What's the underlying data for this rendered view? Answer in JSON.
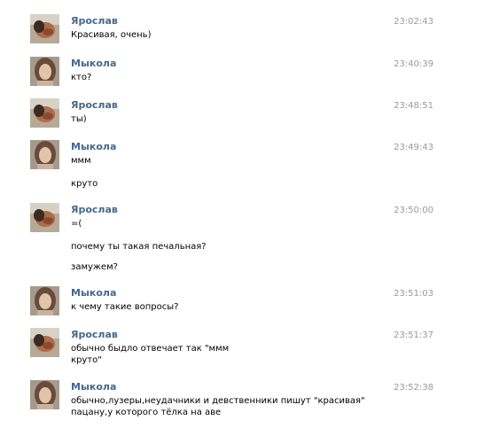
{
  "messages": [
    {
      "author": "Ярослав",
      "avatar": "yaroslav-avatar",
      "time": "23:02:43",
      "lines": [
        "Красивая, очень)"
      ]
    },
    {
      "author": "Мыкола",
      "avatar": "mykola-avatar",
      "time": "23:40:39",
      "lines": [
        "кто?"
      ]
    },
    {
      "author": "Ярослав",
      "avatar": "yaroslav-avatar",
      "time": "23:48:51",
      "lines": [
        "ты)"
      ]
    },
    {
      "author": "Мыкола",
      "avatar": "mykola-avatar",
      "time": "23:49:43",
      "lines": [
        "ммм",
        "круто"
      ]
    },
    {
      "author": "Ярослав",
      "avatar": "yaroslav-avatar",
      "time": "23:50:00",
      "lines": [
        "=(",
        "почему ты такая печальная?",
        "замужем?"
      ]
    },
    {
      "author": "Мыкола",
      "avatar": "mykola-avatar",
      "time": "23:51:03",
      "lines": [
        "к чему такие вопросы?"
      ]
    },
    {
      "author": "Ярослав",
      "avatar": "yaroslav-avatar",
      "time": "23:51:37",
      "lines": [
        "обычно быдло отвечает так \"ммм",
        "круто\""
      ]
    },
    {
      "author": "Мыкола",
      "avatar": "mykola-avatar",
      "time": "23:52:38",
      "lines": [
        "обычно,лузеры,неудачники и девственники пишут \"красивая\"",
        "пацану,у которого тёлка на аве"
      ]
    }
  ],
  "colors": {
    "author_name": "#45688e",
    "timestamp": "#999999",
    "message_text": "#000000"
  }
}
